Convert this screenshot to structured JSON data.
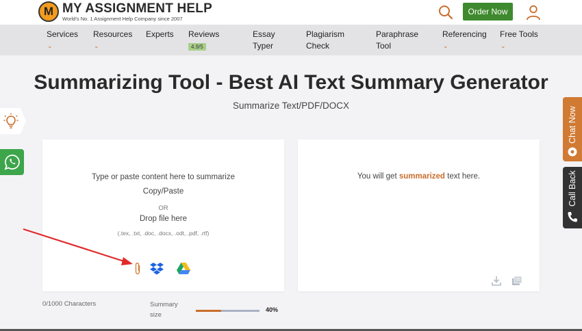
{
  "header": {
    "logo_letter": "M",
    "logo_name": "MY ASSIGNMENT HELP",
    "logo_tagline": "World's No. 1 Assignment Help Company since 2007",
    "order_label": "Order Now",
    "accent_color": "#c96d2a",
    "order_color": "#3f8a2e"
  },
  "nav": {
    "services": "Services",
    "resources": "Resources",
    "experts": "Experts",
    "reviews": "Reviews",
    "reviews_rating": "4.9/5",
    "essay_l1": "Essay",
    "essay_l2": "Typer",
    "plag_l1": "Plagiarism",
    "plag_l2": "Check",
    "para_l1": "Paraphrase",
    "para_l2": "Tool",
    "referencing": "Referencing",
    "free_tools": "Free Tools"
  },
  "page": {
    "title": "Summarizing Tool - Best AI Text Summary Generator",
    "subtitle": "Summarize Text/PDF/DOCX"
  },
  "input_panel": {
    "prompt": "Type or paste content here to summarize",
    "copy_paste": "Copy/Paste",
    "or": "OR",
    "drop": "Drop file here",
    "formats": "(.tex, .txt, .doc, .docx, .odt, .pdf, .rtf)"
  },
  "output_panel": {
    "pre": "You will get ",
    "highlight": "summarized",
    "post": " text here."
  },
  "footer": {
    "char_count": "0/1000 Characters",
    "summary_l1": "Summary",
    "summary_l2": "size",
    "summary_percent": "40%",
    "summary_level": 0.4
  },
  "side": {
    "chat_label": "Chat Now",
    "callback_label": "Call Back"
  },
  "icons": [
    "search-icon",
    "user-icon",
    "bulb-icon",
    "whatsapp-icon",
    "chat-icon",
    "phone-icon",
    "paperclip-icon",
    "dropbox-icon",
    "google-drive-icon",
    "download-icon",
    "copy-icon"
  ]
}
